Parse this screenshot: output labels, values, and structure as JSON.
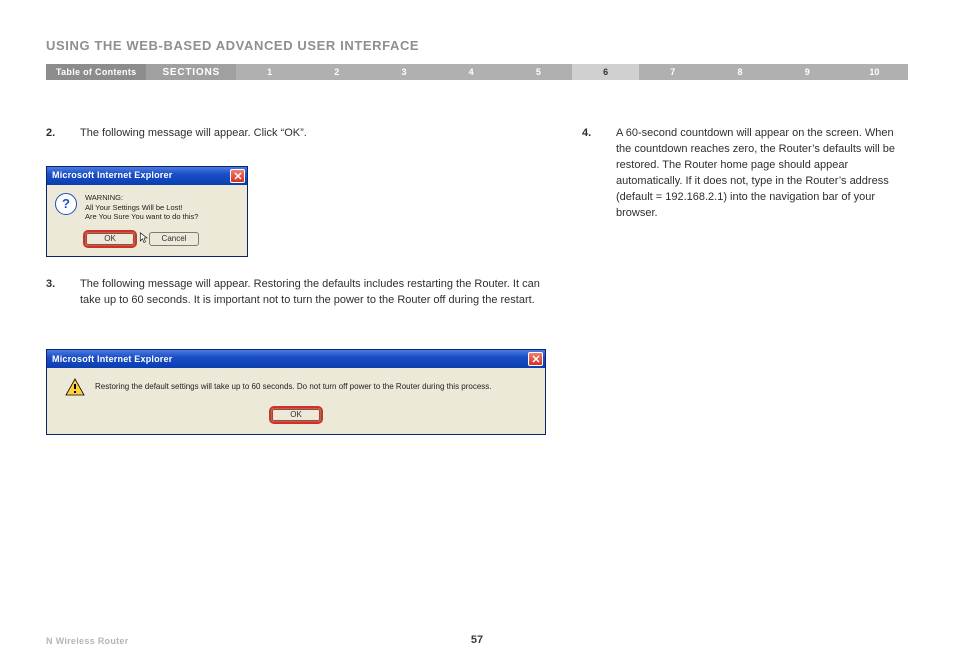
{
  "header": {
    "title": "USING THE WEB-BASED ADVANCED USER INTERFACE"
  },
  "nav": {
    "toc_label": "Table of Contents",
    "sections_label": "SECTIONS",
    "items": [
      "1",
      "2",
      "3",
      "4",
      "5",
      "6",
      "7",
      "8",
      "9",
      "10"
    ],
    "active_index": 5
  },
  "steps": {
    "s2": {
      "num": "2.",
      "text": "The following message will appear. Click “OK”."
    },
    "s3": {
      "num": "3.",
      "text": "The following message will appear. Restoring the defaults includes restarting the Router. It can take up to 60 seconds. It is important not to turn the power to the Router off during the restart."
    },
    "s4": {
      "num": "4.",
      "text": "A 60-second countdown will appear on the screen. When the countdown reaches zero, the Router’s defaults will be restored. The Router home page should appear automatically. If it does not, type in the Router’s address (default = 192.168.2.1) into the navigation bar of your browser."
    }
  },
  "dialog1": {
    "title": "Microsoft Internet Explorer",
    "line1": "WARNING:",
    "line2": "All Your Settings Will be Lost!",
    "line3": "Are You Sure You want to do this?",
    "ok_label": "OK",
    "cancel_label": "Cancel"
  },
  "dialog2": {
    "title": "Microsoft Internet Explorer",
    "message": "Restoring the default settings will take up to 60 seconds. Do not turn off power to the Router during this process.",
    "ok_label": "OK"
  },
  "footer": {
    "left": "N Wireless Router",
    "page": "57"
  }
}
